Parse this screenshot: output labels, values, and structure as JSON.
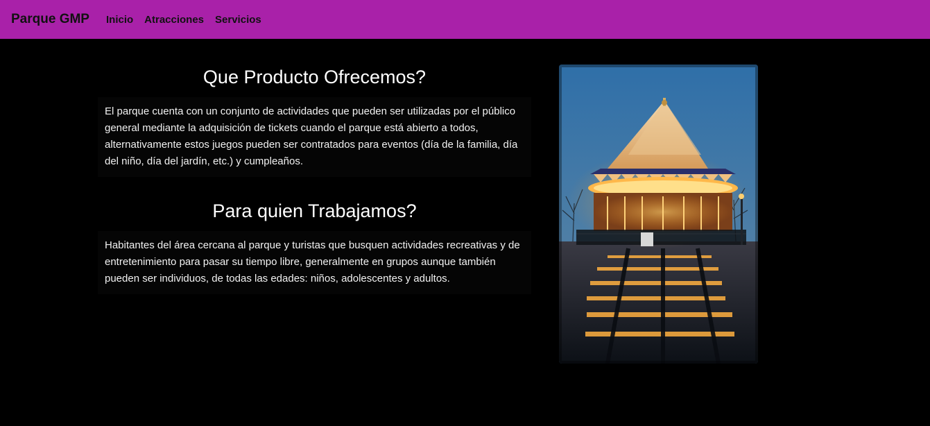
{
  "navbar": {
    "brand": "Parque GMP",
    "links": [
      "Inicio",
      "Atracciones",
      "Servicios"
    ],
    "background": "#a921a9"
  },
  "sections": [
    {
      "title": "Que Producto Ofrecemos?",
      "body": "El parque cuenta con un conjunto de actividades que pueden ser utilizadas por el público general mediante la adquisición de tickets cuando el parque está abierto a todos, alternativamente estos juegos pueden ser contratados para eventos (día de la familia, día del niño, día del jardín, etc.) y cumpleaños."
    },
    {
      "title": "Para quien Trabajamos?",
      "body": "Habitantes del área cercana al parque y turistas que busquen actividades recreativas y de entretenimiento para pasar su tiempo libre, generalmente en grupos aunque también pueden ser individuos, de todas las edades: niños, adolescentes y adultos."
    }
  ],
  "image": {
    "subject": "carousel-at-night-photo"
  }
}
